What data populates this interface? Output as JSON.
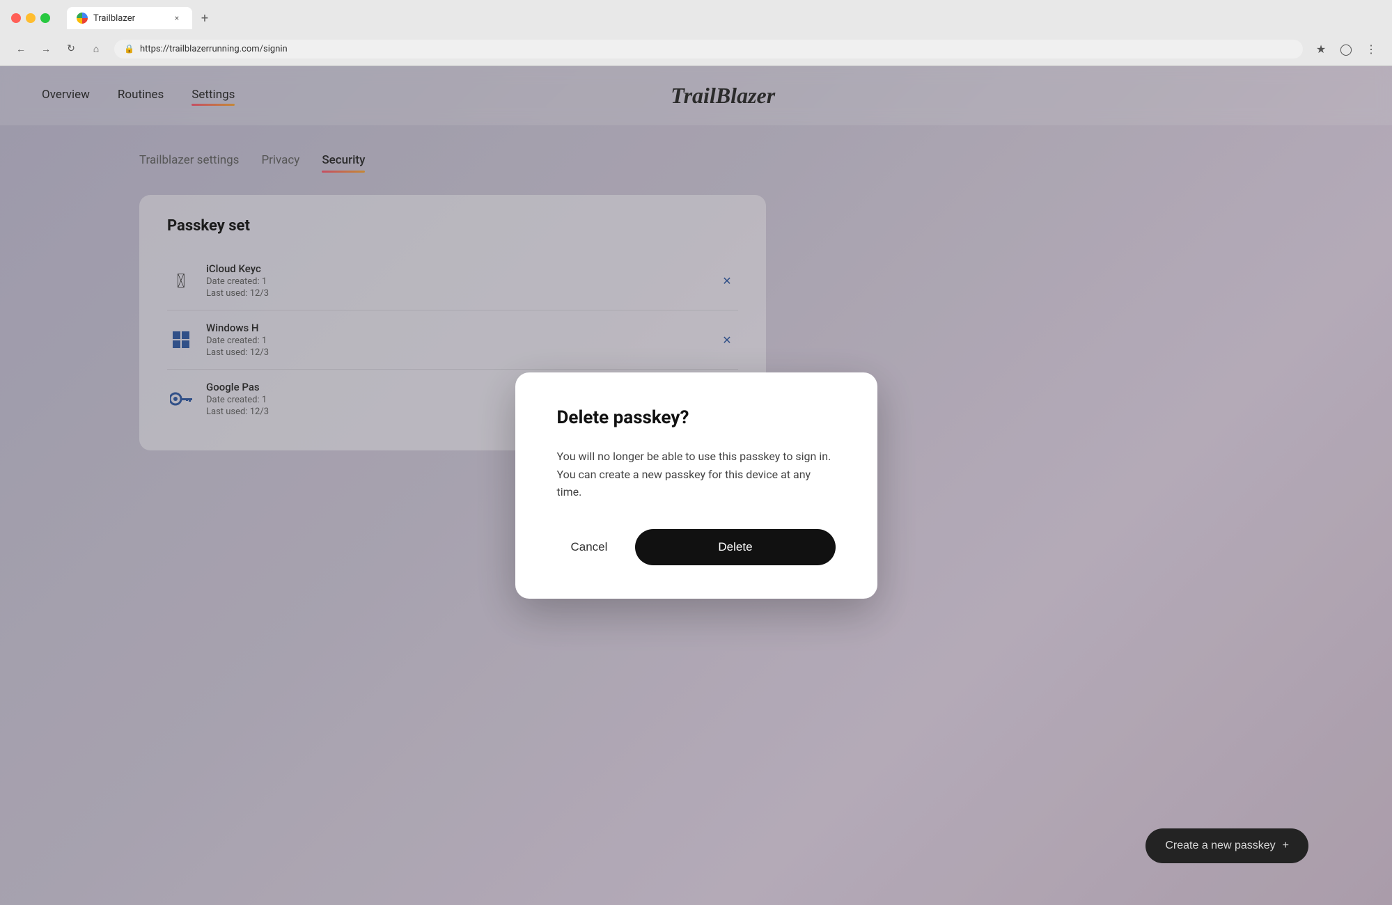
{
  "browser": {
    "tab_title": "Trailblazer",
    "url": "https://trailblazerrunning.com/signin",
    "close_label": "×",
    "new_tab_label": "+"
  },
  "nav": {
    "overview": "Overview",
    "routines": "Routines",
    "settings": "Settings",
    "logo": "TrailBlazer"
  },
  "settings_tabs": [
    {
      "label": "Trailblazer settings",
      "active": false
    },
    {
      "label": "Privacy",
      "active": false
    },
    {
      "label": "Security",
      "active": true
    }
  ],
  "passkey_section": {
    "title": "Passkey set",
    "passkeys": [
      {
        "name": "iCloud Keyc",
        "date_created": "Date created: 1",
        "last_used": "Last used: 12/3",
        "icon_type": "apple"
      },
      {
        "name": "Windows H",
        "date_created": "Date created: 1",
        "last_used": "Last used: 12/3",
        "icon_type": "windows"
      },
      {
        "name": "Google Pas",
        "date_created": "Date created: 1",
        "last_used": "Last used: 12/3",
        "icon_type": "key"
      }
    ]
  },
  "create_passkey": {
    "label": "Create a new passkey",
    "icon": "+"
  },
  "modal": {
    "title": "Delete passkey?",
    "body": "You will no longer be able to use this passkey to sign in. You can create a new passkey for this device at any time.",
    "cancel_label": "Cancel",
    "delete_label": "Delete"
  }
}
